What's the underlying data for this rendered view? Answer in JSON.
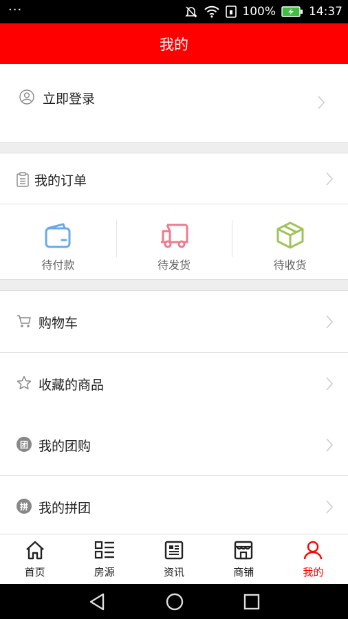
{
  "status_bar": {
    "left": "···",
    "battery": "100%",
    "time": "14:37"
  },
  "header": {
    "title": "我的"
  },
  "login": {
    "label": "立即登录"
  },
  "orders": {
    "title": "我的订单",
    "statuses": [
      {
        "label": "待付款",
        "icon": "wallet-icon",
        "color": "#6aa9e9"
      },
      {
        "label": "待发货",
        "icon": "truck-icon",
        "color": "#f07a8d"
      },
      {
        "label": "待收货",
        "icon": "package-icon",
        "color": "#9fc45a"
      }
    ]
  },
  "menu": [
    {
      "label": "购物车",
      "icon": "cart-icon"
    },
    {
      "label": "收藏的商品",
      "icon": "star-icon"
    },
    {
      "label": "我的团购",
      "icon": "group-buy-icon",
      "glyph": "团"
    },
    {
      "label": "我的拼团",
      "icon": "pin-tuan-icon",
      "glyph": "拼"
    }
  ],
  "tabs": [
    {
      "label": "首页",
      "icon": "home-icon"
    },
    {
      "label": "房源",
      "icon": "listing-icon"
    },
    {
      "label": "资讯",
      "icon": "news-icon"
    },
    {
      "label": "商铺",
      "icon": "shop-icon"
    },
    {
      "label": "我的",
      "icon": "user-icon",
      "active": true
    }
  ],
  "colors": {
    "brand": "#ff0000",
    "separator": "#eeeeee"
  }
}
